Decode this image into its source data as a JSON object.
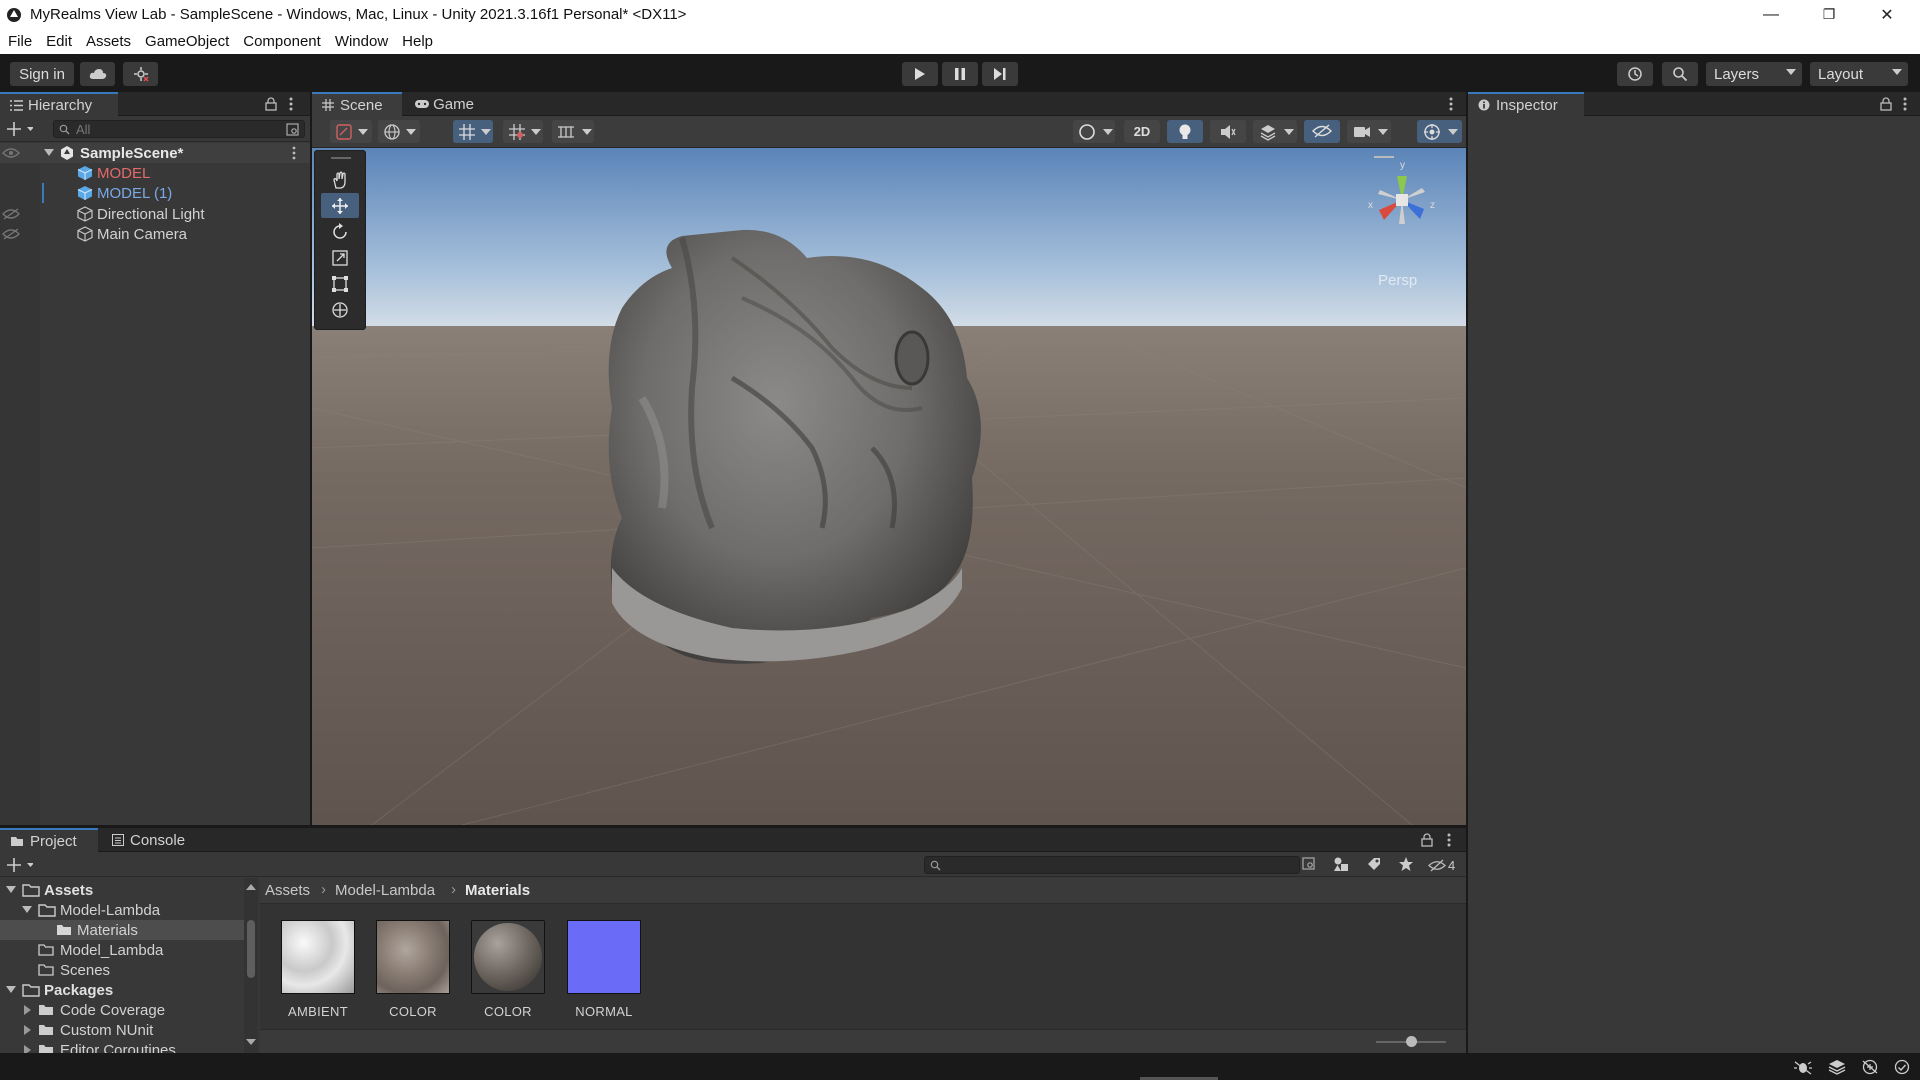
{
  "window": {
    "title": "MyRealms View Lab - SampleScene - Windows, Mac, Linux - Unity 2021.3.16f1 Personal* <DX11>",
    "minimize": "—",
    "maximize": "❐",
    "close": "✕"
  },
  "menu": [
    "File",
    "Edit",
    "Assets",
    "GameObject",
    "Component",
    "Window",
    "Help"
  ],
  "toolbar": {
    "sign_in": "Sign in",
    "layers": "Layers",
    "layout": "Layout"
  },
  "hierarchy": {
    "tab": "Hierarchy",
    "search_placeholder": "All",
    "scene": "SampleScene*",
    "items": [
      {
        "label": "MODEL",
        "color": "#e46a6a"
      },
      {
        "label": "MODEL (1)",
        "color": "#7aa9e6"
      },
      {
        "label": "Directional Light",
        "color": "#d2d2d2"
      },
      {
        "label": "Main Camera",
        "color": "#d2d2d2"
      }
    ]
  },
  "scene_view": {
    "tabs": [
      "Scene",
      "Game"
    ],
    "btn_2d": "2D",
    "gizmo_label": "Persp",
    "gizmo_axes": {
      "y": "y",
      "x": "x",
      "z": "z"
    }
  },
  "inspector": {
    "tab": "Inspector"
  },
  "project": {
    "tabs": [
      "Project",
      "Console"
    ],
    "tree": [
      {
        "label": "Assets",
        "bold": true
      },
      {
        "label": "Model-Lambda"
      },
      {
        "label": "Materials"
      },
      {
        "label": "Model_Lambda"
      },
      {
        "label": "Scenes"
      },
      {
        "label": "Packages",
        "bold": true
      },
      {
        "label": "Code Coverage"
      },
      {
        "label": "Custom NUnit"
      },
      {
        "label": "Editor Coroutines"
      }
    ],
    "breadcrumb": [
      "Assets",
      "Model-Lambda",
      "Materials"
    ],
    "hidden_count": "4",
    "assets": [
      {
        "label": "AMBIENT"
      },
      {
        "label": "COLOR"
      },
      {
        "label": "COLOR"
      },
      {
        "label": "NORMAL"
      }
    ],
    "zoom_level": 0.5
  },
  "colors": {
    "accent": "#3a79bb",
    "panel": "#383838",
    "header": "#282828",
    "normal_map": "#6a6cf8"
  }
}
